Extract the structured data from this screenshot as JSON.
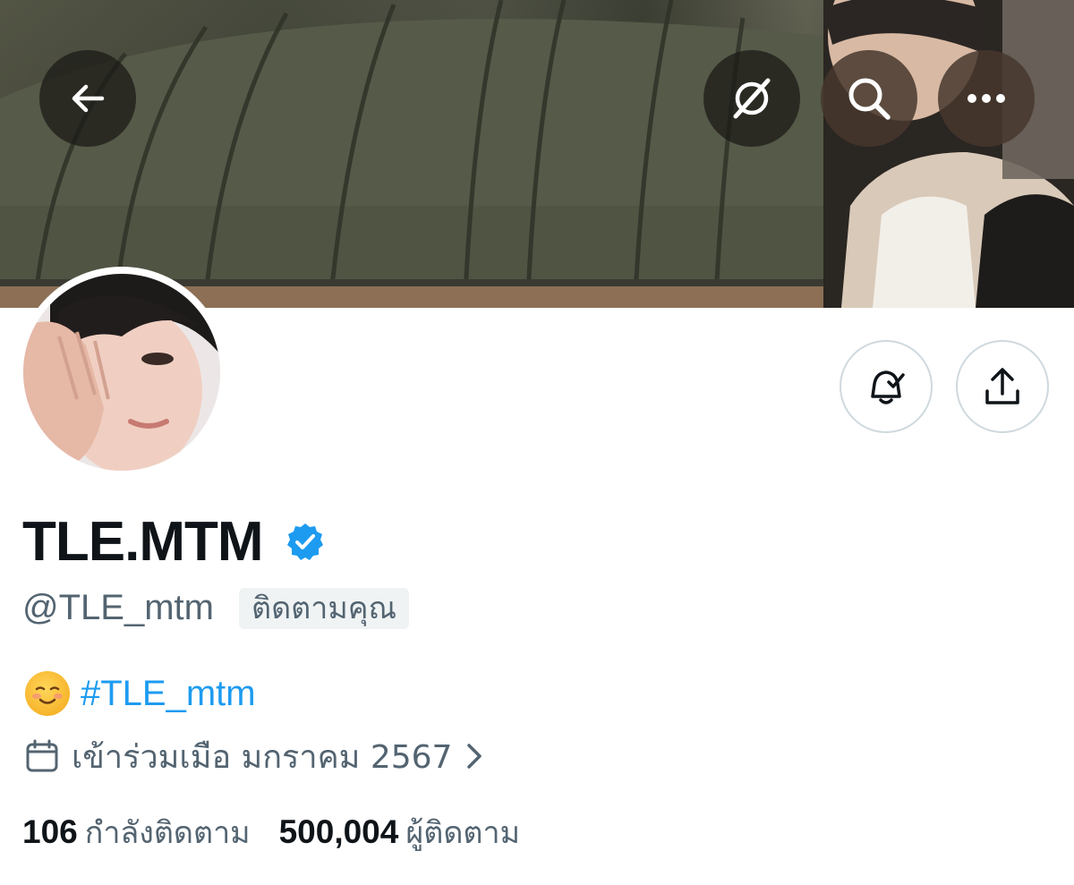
{
  "header": {
    "back_icon": "arrow-left-icon",
    "translate_icon": "grok-slash-icon",
    "search_icon": "search-icon",
    "more_icon": "more-horizontal-icon"
  },
  "profile": {
    "display_name": "TLE.MTM",
    "verified": true,
    "verified_color": "#1d9bf0",
    "handle": "@TLE_mtm",
    "follows_you_label": "ติดตามคุณ",
    "bio_emoji": "☺️",
    "bio_hashtag": "#TLE_mtm",
    "joined_text": "เข้าร่วมเมือ มกราคม 2567",
    "following_count": "106",
    "following_label": "กำลังติดตาม",
    "followers_count": "500,004",
    "followers_label": "ผู้ติดตาม"
  },
  "actions": {
    "notifications_icon": "bell-check-icon",
    "share_icon": "share-upload-icon"
  },
  "colors": {
    "text_primary": "#0f1419",
    "text_secondary": "#536471",
    "accent": "#1d9bf0",
    "badge_bg": "#eff3f4",
    "border": "#cfd9de"
  }
}
